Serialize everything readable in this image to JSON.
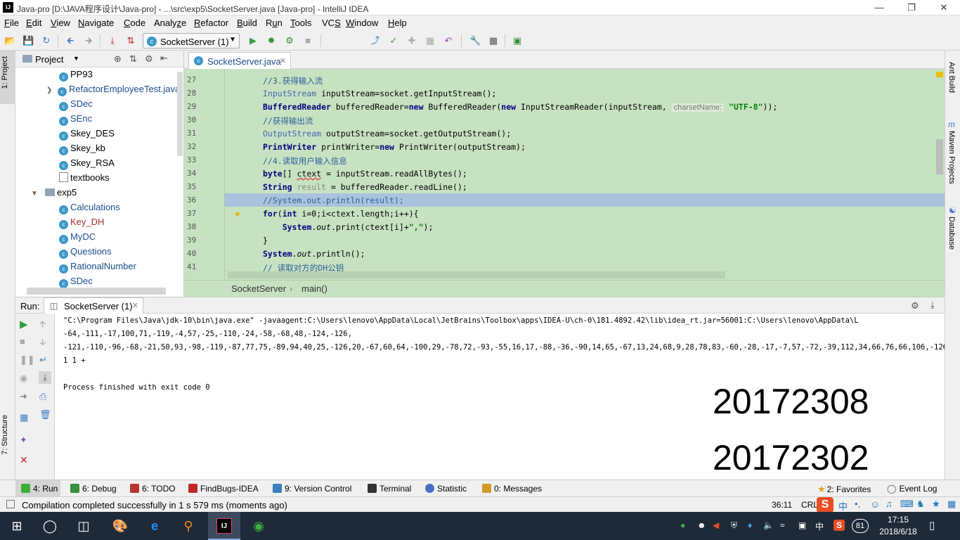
{
  "window": {
    "title": "Java-pro [D:\\JAVA程序设计\\Java-pro] - ...\\src\\exp5\\SocketServer.java [Java-pro] - IntelliJ IDEA",
    "app_icon": "IJ"
  },
  "menu": [
    {
      "label": "File",
      "u": "F"
    },
    {
      "label": "Edit",
      "u": "E"
    },
    {
      "label": "View",
      "u": "V"
    },
    {
      "label": "Navigate",
      "u": "N"
    },
    {
      "label": "Code",
      "u": "C"
    },
    {
      "label": "Analyze",
      "u": "z"
    },
    {
      "label": "Refactor",
      "u": "R"
    },
    {
      "label": "Build",
      "u": "B"
    },
    {
      "label": "Run",
      "u": "u"
    },
    {
      "label": "Tools",
      "u": "T"
    },
    {
      "label": "VCS",
      "u": "S"
    },
    {
      "label": "Window",
      "u": "W"
    },
    {
      "label": "Help",
      "u": "H"
    }
  ],
  "toolbar": {
    "run_config": "SocketServer (1)"
  },
  "left_strip": {
    "project_tab": "1: Project",
    "structure_tab": "7: Structure"
  },
  "project": {
    "title": "Project",
    "items": [
      {
        "label": "PP93",
        "kind": "class"
      },
      {
        "label": "RefactorEmployeeTest.java",
        "kind": "class"
      },
      {
        "label": "SDec",
        "kind": "class"
      },
      {
        "label": "SEnc",
        "kind": "class"
      },
      {
        "label": "Skey_DES",
        "kind": "class"
      },
      {
        "label": "Skey_kb",
        "kind": "class"
      },
      {
        "label": "Skey_RSA",
        "kind": "class"
      },
      {
        "label": "textbooks",
        "kind": "file"
      },
      {
        "label": "exp5",
        "kind": "folder"
      },
      {
        "label": "Calculations",
        "kind": "class"
      },
      {
        "label": "Key_DH",
        "kind": "class"
      },
      {
        "label": "MyDC",
        "kind": "class"
      },
      {
        "label": "Questions",
        "kind": "class"
      },
      {
        "label": "RationalNumber",
        "kind": "class"
      },
      {
        "label": "SDec",
        "kind": "class"
      }
    ]
  },
  "editor": {
    "tab_label": "SocketServer.java",
    "line_numbers": [
      "27",
      "28",
      "29",
      "30",
      "31",
      "32",
      "33",
      "34",
      "35",
      "36",
      "37",
      "38",
      "39",
      "40",
      "41"
    ],
    "hint_label": "charsetName:",
    "breadcrumb": {
      "class": "SocketServer",
      "method": "main()"
    }
  },
  "right_strip": {
    "tabs": [
      "Ant Build",
      "Maven Projects",
      "Database"
    ]
  },
  "run_panel": {
    "label": "Run:",
    "tab_label": "SocketServer (1)",
    "console": [
      "\"C:\\Program Files\\Java\\jdk-10\\bin\\java.exe\" -javaagent:C:\\Users\\lenovo\\AppData\\Local\\JetBrains\\Toolbox\\apps\\IDEA-U\\ch-0\\181.4892.42\\lib\\idea_rt.jar=56001:C:\\Users\\lenovo\\AppData\\L",
      "-64,-111,-17,100,71,-119,-4,57,-25,-110,-24,-58,-68,48,-124,-126,",
      "-121,-110,-96,-68,-21,50,93,-98,-119,-87,77,75,-89,94,40,25,-126,20,-67,60,64,-100,29,-78,72,-93,-55,16,17,-88,-36,-90,14,65,-67,13,24,68,9,28,78,83,-60,-28,-17,-7,57,-72,-39,112,34,66,76,66,106,-126,61,30,-16",
      "1 1 +",
      "",
      "Process finished with exit code 0"
    ],
    "overlay_numbers": [
      "20172308",
      "20172302"
    ]
  },
  "bottom_tabs": [
    {
      "label": "4: Run",
      "icon": "run-icon",
      "color": "#3cae3c"
    },
    {
      "label": "6: Debug",
      "icon": "debug-icon",
      "color": "#3a8f3a"
    },
    {
      "label": "6: TODO",
      "icon": "todo-icon",
      "color": "#b7342f"
    },
    {
      "label": "FindBugs-IDEA",
      "icon": "findbugs-icon",
      "color": "#c02828"
    },
    {
      "label": "9: Version Control",
      "icon": "version-control-icon",
      "color": "#3d7ebf"
    },
    {
      "label": "Terminal",
      "icon": "terminal-icon",
      "color": "#333333"
    },
    {
      "label": "Statistic",
      "icon": "statistic-icon",
      "color": "#4a6fc2"
    },
    {
      "label": "0: Messages",
      "icon": "messages-icon",
      "color": "#d29a2a"
    },
    {
      "label": "2: Favorites",
      "icon": "favorites-icon",
      "color": "#e0a020"
    },
    {
      "label": "Event Log",
      "icon": "event-log-icon",
      "color": "#555555"
    }
  ],
  "status": {
    "message": "Compilation completed successfully in 1 s 579 ms (moments ago)",
    "position": "36:11",
    "line_sep": "CRL"
  },
  "taskbar": {
    "ime": "中",
    "badge": "81",
    "time": "17:15",
    "date": "2018/6/18"
  }
}
